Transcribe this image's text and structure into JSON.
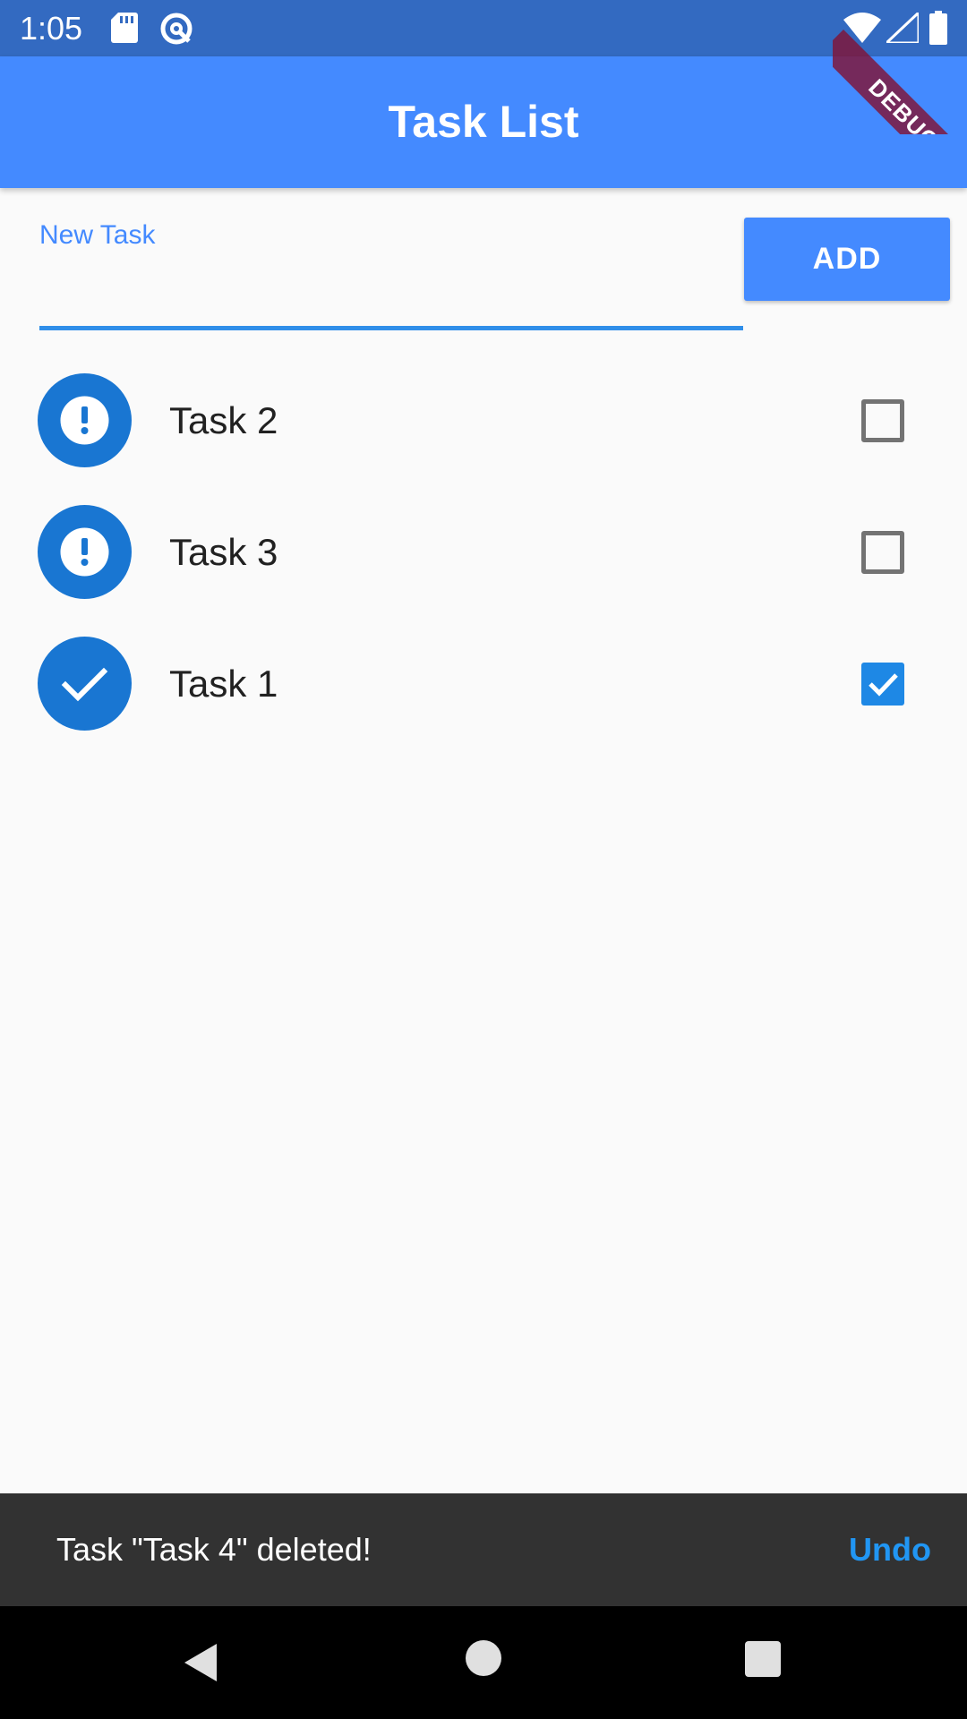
{
  "status_bar": {
    "time": "1:05",
    "icons": [
      "sd-card-icon",
      "q-app-icon",
      "wifi-icon",
      "signal-icon",
      "battery-icon"
    ]
  },
  "app_bar": {
    "title": "Task List",
    "color": "#448aff"
  },
  "debug_banner": "DEBUG",
  "new_task": {
    "label": "New Task",
    "value": "",
    "button_label": "ADD"
  },
  "tasks": [
    {
      "name": "Task 2",
      "status_icon": "alert-icon",
      "done": false
    },
    {
      "name": "Task 3",
      "status_icon": "alert-icon",
      "done": false
    },
    {
      "name": "Task 1",
      "status_icon": "check-icon",
      "done": true
    }
  ],
  "snackbar": {
    "message": "Task \"Task 4\" deleted!",
    "action": "Undo"
  },
  "nav_bar": {
    "icons": [
      "back-icon",
      "home-icon",
      "recents-icon"
    ]
  },
  "colors": {
    "status_bar": "#336ac1",
    "primary": "#448aff",
    "avatar": "#1976d2",
    "checkbox_checked": "#1e88e5",
    "snackbar": "#323232",
    "snackbar_action": "#2196f3"
  }
}
